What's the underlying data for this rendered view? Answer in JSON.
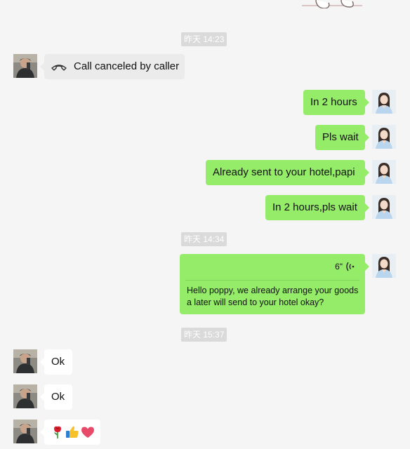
{
  "timestamps": [
    "昨天 14:23",
    "昨天 14:34",
    "昨天 15:37"
  ],
  "messages": {
    "call": "Call canceled by caller",
    "m1": "In 2 hours",
    "m2": "Pls wait",
    "m3": "Already sent to your hotel,papi",
    "m4": "In 2 hours,pls wait",
    "voice_duration": "6\"",
    "voice_transcript": "Hello poppy, we already arrange your goods a later will send to your hotel okay?",
    "r1": "Ok",
    "r2": "Ok"
  },
  "emoji_message": [
    "rose",
    "thumbs-up",
    "red-heart"
  ],
  "icons": {
    "call": "phone-hangup-icon",
    "voice": "voice-wave-icon"
  },
  "colors": {
    "background": "#f5f5f5",
    "my_bubble": "#95ec69",
    "their_bubble": "#ffffff",
    "timestamp_bg": "#dadada"
  }
}
